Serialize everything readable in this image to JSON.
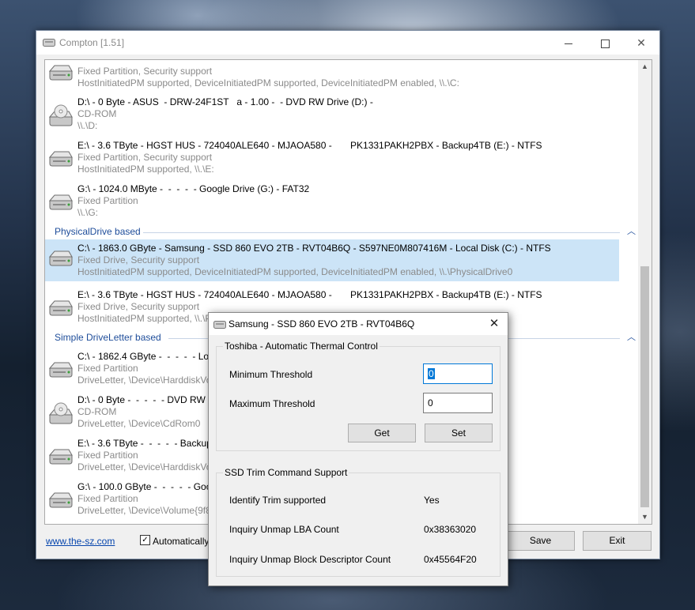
{
  "app": {
    "title": "Compton [1.51]",
    "footer_link": "www.the-sz.com",
    "auto_checkbox_label": "Automatically",
    "save_label": "Save",
    "exit_label": "Exit"
  },
  "groups": [
    {
      "title": "PhysicalDrive based"
    },
    {
      "title": "Simple DriveLetter based"
    }
  ],
  "items": [
    {
      "line1": "",
      "line2": "Fixed Partition, Security support",
      "line3": "HostInitiatedPM supported, DeviceInitiatedPM supported, DeviceInitiatedPM enabled, \\\\.\\C:",
      "icon": "hard-drive"
    },
    {
      "line1": "D:\\ - 0 Byte - ASUS  - DRW-24F1ST   a - 1.00 -  - DVD RW Drive (D:) -",
      "line2": "CD-ROM",
      "line3": "\\\\.\\D:",
      "icon": "optical-drive"
    },
    {
      "line1": "E:\\ - 3.6 TByte - HGST HUS - 724040ALE640 - MJAOA580 -       PK1331PAKH2PBX - Backup4TB (E:) - NTFS",
      "line2": "Fixed Partition, Security support",
      "line3": "HostInitiatedPM supported, \\\\.\\E:",
      "icon": "hard-drive"
    },
    {
      "line1": "G:\\ - 1024.0 MByte -  -  -  -  - Google Drive (G:) - FAT32",
      "line2": "Fixed Partition",
      "line3": "\\\\.\\G:",
      "icon": "hard-drive"
    },
    {
      "line1": "C:\\ - 1863.0 GByte - Samsung - SSD 860 EVO 2TB - RVT04B6Q - S597NE0M807416M - Local Disk (C:) - NTFS",
      "line2": "Fixed Drive, Security support",
      "line3": "HostInitiatedPM supported, DeviceInitiatedPM supported, DeviceInitiatedPM enabled, \\\\.\\PhysicalDrive0",
      "icon": "hard-drive"
    },
    {
      "line1": "E:\\ - 3.6 TByte - HGST HUS - 724040ALE640 - MJAOA580 -       PK1331PAKH2PBX - Backup4TB (E:) - NTFS",
      "line2": "Fixed Drive, Security support",
      "line3": "HostInitiatedPM supported, \\\\.\\PhysicalDrive1",
      "icon": "hard-drive"
    },
    {
      "line1": "C:\\ - 1862.4 GByte -  -  -  -  - Local Disk (C:) - NTFS",
      "line2": "Fixed Partition",
      "line3": "DriveLetter, \\Device\\HarddiskVolume3",
      "icon": "hard-drive"
    },
    {
      "line1": "D:\\ - 0 Byte -  -  -  -  - DVD RW Drive (D:) -",
      "line2": "CD-ROM",
      "line3": "DriveLetter, \\Device\\CdRom0",
      "icon": "optical-drive"
    },
    {
      "line1": "E:\\ - 3.6 TByte -  -  -  -  - Backup4TB (E:) - NTFS",
      "line2": "Fixed Partition",
      "line3": "DriveLetter, \\Device\\HarddiskVolume6",
      "icon": "hard-drive"
    },
    {
      "line1": "G:\\ - 100.0 GByte -  -  -  -  - Google Drive (G:) - FAT32",
      "line2": "Fixed Partition",
      "line3": "DriveLetter, \\Device\\Volume{9f8...}",
      "icon": "hard-drive"
    }
  ],
  "dialog": {
    "title": "Samsung - SSD 860 EVO 2TB - RVT04B6Q",
    "thermal": {
      "title": "Toshiba - Automatic Thermal Control",
      "min_label": "Minimum Threshold",
      "min_value": "0",
      "max_label": "Maximum Threshold",
      "max_value": "0",
      "get_label": "Get",
      "set_label": "Set"
    },
    "trim": {
      "title": "SSD Trim Command Support",
      "rows": [
        {
          "label": "Identify Trim supported",
          "value": "Yes"
        },
        {
          "label": "Inquiry Unmap LBA Count",
          "value": "0x38363020"
        },
        {
          "label": "Inquiry Unmap Block Descriptor Count",
          "value": "0x45564F20"
        }
      ]
    }
  },
  "colors": {
    "selection": "#cce4f7",
    "group_header": "#1e4d9a",
    "link": "#0645ad"
  }
}
